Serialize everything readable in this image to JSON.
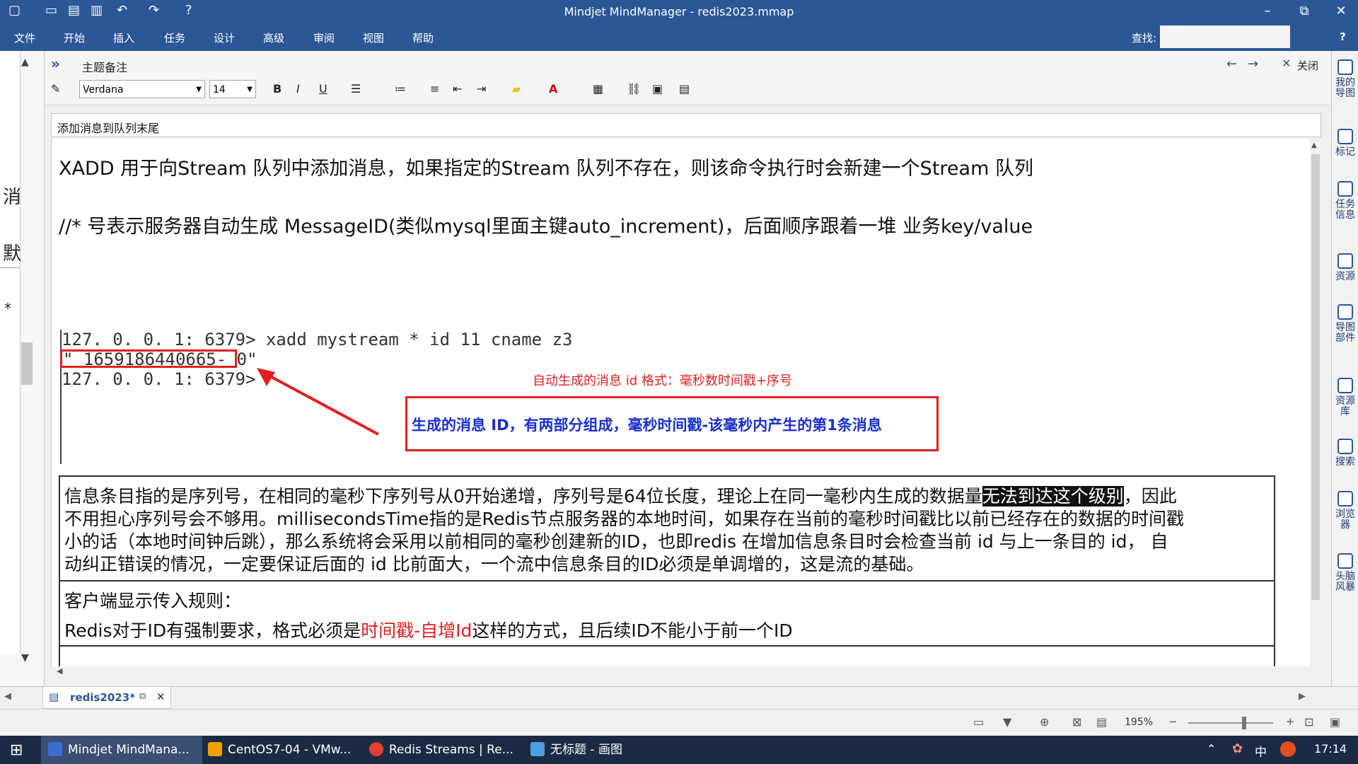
{
  "window": {
    "title": "Mindjet MindManager - redis2023.mmap",
    "controls": {
      "minimize": "–",
      "restore": "⧉",
      "close": "✕"
    }
  },
  "qat": {
    "items": [
      "▢",
      "▭",
      "▤",
      "▥",
      "↶",
      "↷",
      "?"
    ]
  },
  "menu": {
    "items": [
      "文件",
      "开始",
      "插入",
      "任务",
      "设计",
      "高级",
      "审阅",
      "视图",
      "帮助"
    ],
    "search_label": "查找:",
    "help": "?"
  },
  "left_panel": {
    "chars": [
      "消",
      "默",
      "*"
    ]
  },
  "notes": {
    "header_title": "主题备注",
    "expand": "»",
    "close_label": "关闭",
    "font": "Verdana",
    "size": "14",
    "bold": "B",
    "italic": "I",
    "underline": "U",
    "topic": "添加消息到队列末尾"
  },
  "content": {
    "line1": "XADD 用于向Stream 队列中添加消息，如果指定的Stream 队列不存在，则该命令执行时会新建一个Stream 队列",
    "line2": "//* 号表示服务器自动生成 MessageID(类似mysql里面主键auto_increment)，后面顺序跟着一堆 业务key/value",
    "cmd1": "127. 0. 0. 1: 6379> xadd mystream * id 11 cname z3",
    "cmd2": "\" 1659186440665- 0\"",
    "cmd3": "127. 0. 0. 1: 6379>",
    "annotation_red": "自动生成的消息 id 格式：毫秒数时间戳+序号",
    "box_text": "生成的消息 ID，有两部分组成，毫秒时间戳-该毫秒内产生的第1条消息",
    "para_line1_a": "信息条目指的是序列号，在相同的毫秒下序列号从0开始递增，序列号是64位长度，理论上在同一毫秒内生成的数据量",
    "para_line1_hl": "无法到达这个级别",
    "para_line1_b": "，因此",
    "para_line2": "不用担心序列号会不够用。millisecondsTime指的是Redis节点服务器的本地时间，如果存在当前的毫秒时间戳比以前已经存在的数据的时间戳",
    "para_line3": "小的话（本地时间钟后跳），那么系统将会采用以前相同的毫秒创建新的ID，也即redis 在增加信息条目时会检查当前 id 与上一条目的 id，  自",
    "para_line4": "动纠正错误的情况，一定要保证后面的 id 比前面大，一个流中信息条目的ID必须是单调增的，这是流的基础。",
    "client_title": "客户端显示传入规则：",
    "rule_a": "Redis对于ID有强制要求，格式必须是",
    "rule_red": "时间戳-自增Id",
    "rule_b": "这样的方式，且后续ID不能小于前一个ID"
  },
  "right_sidebar": {
    "items": [
      "我的导图",
      "标记",
      "任务信息",
      "资源",
      "导图部件",
      "资源库",
      "搜索",
      "浏览器",
      "头脑风暴"
    ]
  },
  "tabs": {
    "doc": "redis2023*"
  },
  "status": {
    "zoom": "195%"
  },
  "taskbar": {
    "items": [
      "Mindjet MindMana...",
      "CentOS7-04 - VMw...",
      "Redis Streams | Re...",
      "无标题 - 画图"
    ],
    "ime": "中",
    "time": "17:14"
  },
  "colors": {
    "titlebar": "#2b5797",
    "annotation_red": "#e02020",
    "box_blue_text": "#1a2fd0",
    "taskbar": "#1c2b44"
  }
}
